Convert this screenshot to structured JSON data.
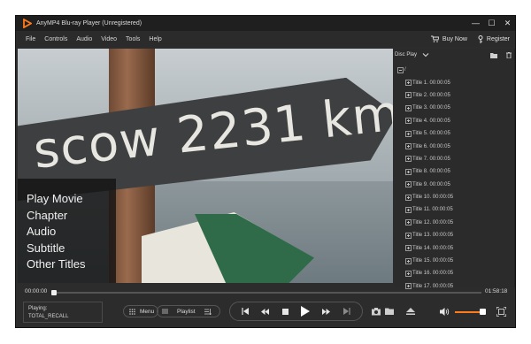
{
  "app": {
    "title": "AnyMP4 Blu-ray Player (Unregistered)"
  },
  "window_controls": {
    "minimize": "—",
    "maximize": "☐",
    "close": "✕"
  },
  "menubar": {
    "items": [
      "File",
      "Controls",
      "Audio",
      "Video",
      "Tools",
      "Help"
    ],
    "buy_now": "Buy Now",
    "register": "Register"
  },
  "video": {
    "sign_text": "scow 2231 km",
    "disc_menu": [
      "Play Movie",
      "Chapter",
      "Audio",
      "Subtitle",
      "Other Titles"
    ]
  },
  "panel": {
    "mode": "Disc Play",
    "root": "/",
    "titles": [
      "Title 1. 00:00:05",
      "Title 2. 00:00:05",
      "Title 3. 00:00:05",
      "Title 4. 00:00:05",
      "Title 5. 00:00:05",
      "Title 6. 00:00:05",
      "Title 7. 00:00:05",
      "Title 8. 00:00:05",
      "Title 9. 00:00:05",
      "Title 10. 00:00:05",
      "Title 11. 00:00:05",
      "Title 12. 00:00:05",
      "Title 13. 00:00:05",
      "Title 14. 00:00:05",
      "Title 15. 00:00:05",
      "Title 16. 00:00:05",
      "Title 17. 00:00:05"
    ]
  },
  "playback": {
    "current_time": "00:00:00",
    "total_time": "01:58:18",
    "progress": 0.0,
    "volume": 0.82
  },
  "now_playing": {
    "label": "Playing:",
    "title": "TOTAL_RECALL"
  },
  "controls": {
    "menu_label": "Menu",
    "playlist_label": "Playlist"
  },
  "colors": {
    "accent": "#ff7a1a",
    "background": "#2c2c2c",
    "titlebar": "#1f1f1f"
  }
}
